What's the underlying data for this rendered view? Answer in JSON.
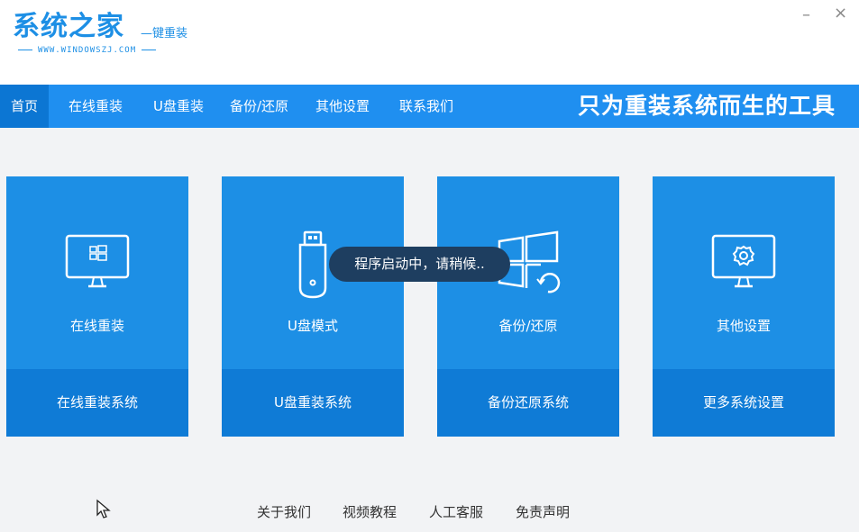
{
  "app": {
    "logo_text": "系统之家",
    "logo_sub": "—键重装",
    "logo_url": "WWW.WINDOWSZJ.COM",
    "window_controls": {
      "minimize": "–",
      "close": "×"
    }
  },
  "nav": {
    "items": [
      {
        "label": "首页",
        "active": true
      },
      {
        "label": "在线重装"
      },
      {
        "label": "U盘重装"
      },
      {
        "label": "备份/还原"
      },
      {
        "label": "其他设置"
      },
      {
        "label": "联系我们"
      }
    ],
    "slogan": "只为重装系统而生的工具"
  },
  "cards": [
    {
      "icon": "monitor-windows-icon",
      "label": "在线重装",
      "action": "在线重装系统"
    },
    {
      "icon": "usb-drive-icon",
      "label": "U盘模式",
      "action": "U盘重装系统"
    },
    {
      "icon": "windows-restore-icon",
      "label": "备份/还原",
      "action": "备份还原系统"
    },
    {
      "icon": "monitor-gear-icon",
      "label": "其他设置",
      "action": "更多系统设置"
    }
  ],
  "toast": {
    "text": "程序启动中，请稍候.."
  },
  "footer": {
    "links": [
      "关于我们",
      "视频教程",
      "人工客服",
      "免责声明"
    ]
  },
  "colors": {
    "accent": "#1f8ff0",
    "card": "#1d8fe5",
    "card_bottom": "#0f7bd6",
    "toast": "#1e3e60"
  }
}
